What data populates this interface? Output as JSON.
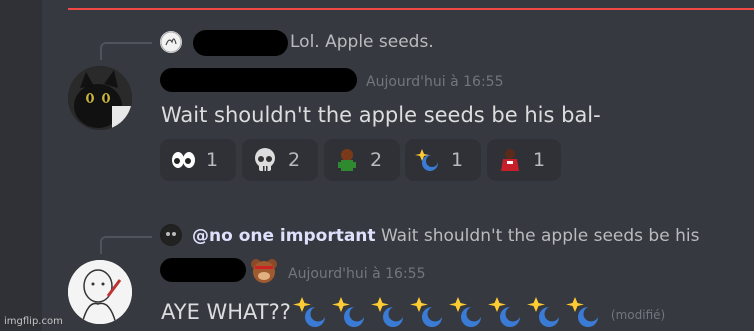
{
  "messages": [
    {
      "reply_preview": "Lol. Apple seeds.",
      "timestamp": "Aujourd'hui à 16:55",
      "text": "Wait shouldn't the apple seeds be his bal-",
      "reactions": [
        {
          "emoji": "eyes-icon",
          "count": "1"
        },
        {
          "emoji": "skull-icon",
          "count": "2"
        },
        {
          "emoji": "custom-emoji-green",
          "count": "2"
        },
        {
          "emoji": "sparkle-moon-icon",
          "count": "1"
        },
        {
          "emoji": "custom-emoji-red",
          "count": "1"
        }
      ]
    },
    {
      "reply_mention": "@no one important",
      "reply_preview": "Wait shouldn't the apple seeds be his",
      "timestamp": "Aujourd'hui à 16:55",
      "text": "AYE WHAT??",
      "emoji_count": 8,
      "edited": "(modifié)"
    }
  ],
  "watermark": "imgflip.com",
  "colors": {
    "background": "#36393f",
    "reaction_bg": "#2f3136",
    "divider": "#f04747"
  }
}
